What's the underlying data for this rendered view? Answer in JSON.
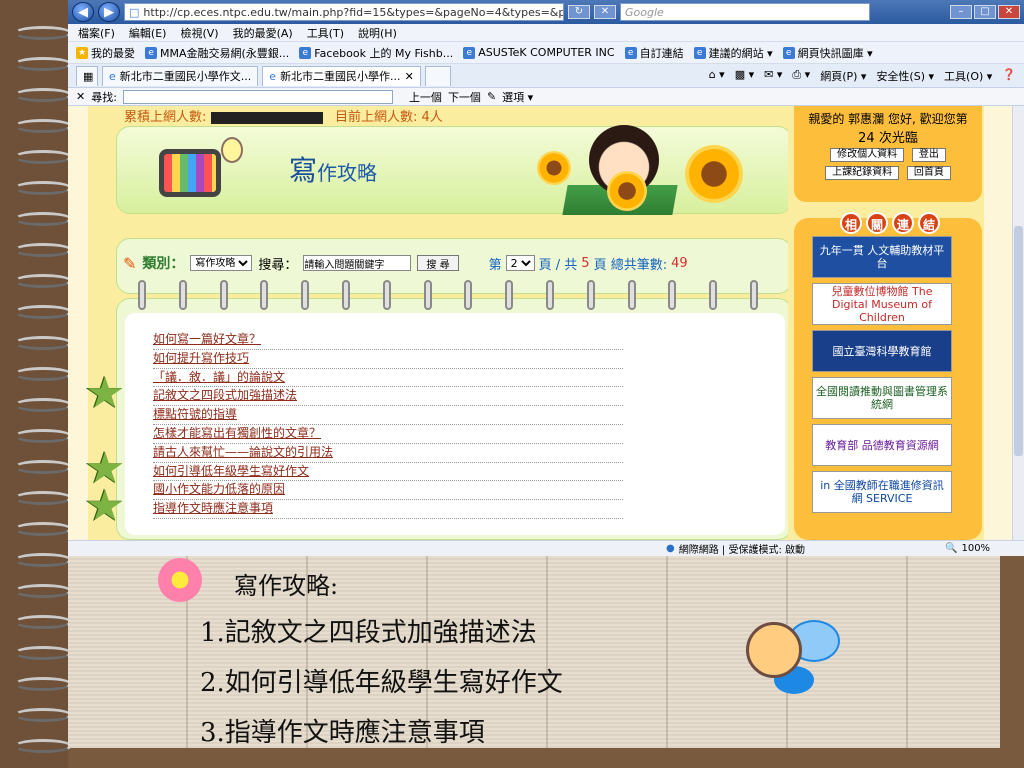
{
  "browser": {
    "url": "http://cp.eces.ntpc.edu.tw/main.php?fid=15&types=&pageNo=4&types=&p",
    "search_placeholder": "Google",
    "menu": [
      "檔案(F)",
      "編輯(E)",
      "檢視(V)",
      "我的最愛(A)",
      "工具(T)",
      "說明(H)"
    ],
    "favorites": [
      "我的最愛",
      "MMA金融交易網(永豐銀...",
      "Facebook 上的 My Fishb...",
      "ASUSTeK COMPUTER INC",
      "自訂連結",
      "建議的網站 ▾",
      "網頁快訊圖庫 ▾"
    ],
    "tabs": [
      "新北市二重國民小學作文...",
      "新北市二重國民小學作..."
    ],
    "commands": [
      "網頁(P) ▾",
      "安全性(S) ▾",
      "工具(O) ▾"
    ],
    "find_label": "尋找:",
    "find_prev": "上一個",
    "find_next": "下一個",
    "find_options": "選項 ▾",
    "status_zone": "網際網路 | 受保護模式: 啟動",
    "zoom": "100%"
  },
  "page": {
    "stats_prefix": "累積上網人數:",
    "stats_online": "目前上網人數: 4人",
    "banner_title_big": "寫",
    "banner_title_rest": "作攻略",
    "category_label": "類別：",
    "category_value": "寫作攻略",
    "search_label": "搜尋：",
    "search_placeholder": "請輸入問題關鍵字",
    "search_button": "搜 尋",
    "pager_prefix": "第",
    "pager_page": "2",
    "pager_mid": "頁 / 共",
    "pager_total_pages": "5",
    "pager_mid2": "頁 總共筆數:",
    "pager_total_items": "49",
    "articles": [
      "如何寫一篇好文章？",
      "如何提升寫作技巧",
      "「議．敘．議」的論說文",
      "記敘文之四段式加強描述法",
      "標點符號的指導",
      "怎樣才能寫出有獨創性的文章？",
      "請古人來幫忙——論說文的引用法",
      "如何引導低年級學生寫好作文",
      "國小作文能力低落的原因",
      "指導作文時應注意事項"
    ],
    "starred_rows": [
      3,
      7,
      9
    ],
    "user_line1": "親愛的 郭惠瀾 您好, 歡迎您第",
    "user_line2": "24 次光臨",
    "btn_edit_profile": "修改個人資料",
    "btn_logout": "登出",
    "btn_records": "上課紀錄資料",
    "btn_home": "回首頁",
    "links_title": [
      "相",
      "關",
      "連",
      "結"
    ],
    "link_banners": [
      "九年一貫 人文輔助教材平台",
      "兒童數位博物館 The Digital Museum of Children",
      "國立臺灣科學教育館",
      "全國閱讀推動與圖書管理系統網",
      "教育部 品德教育資源網",
      "in 全國教師在職進修資訊網 SERVICE"
    ]
  },
  "slide": {
    "heading": "寫作攻略:",
    "items": [
      "1.記敘文之四段式加強描述法",
      "2.如何引導低年級學生寫好作文",
      "3.指導作文時應注意事項"
    ]
  }
}
